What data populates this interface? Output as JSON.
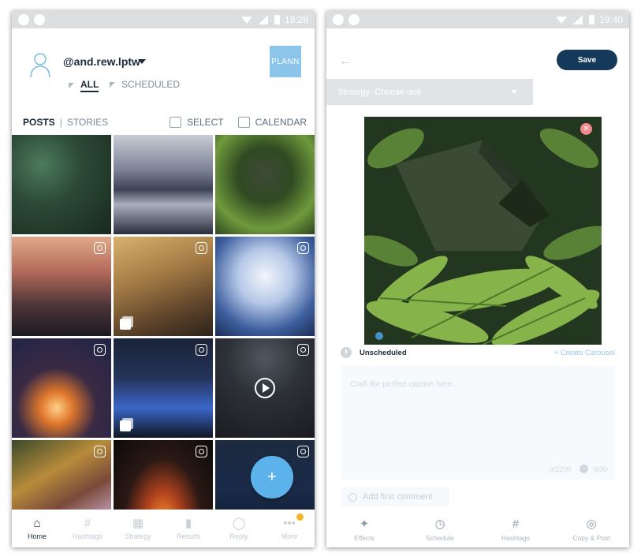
{
  "left_screen": {
    "status_bar": {
      "time": "19:28"
    },
    "header": {
      "username": "@and.rew.lptw",
      "logo_text": "PLANN",
      "filters": [
        {
          "label": "ALL",
          "active": true
        },
        {
          "label": "SCHEDULED",
          "active": false
        }
      ]
    },
    "tabs": {
      "posts": "POSTS",
      "separator": "|",
      "stories": "STORIES"
    },
    "actions": {
      "select": "SELECT",
      "calendar": "CALENDAR"
    },
    "grid_tiles": [
      {
        "theme": "green-leaves",
        "instagram": false,
        "multi": false,
        "video": false
      },
      {
        "theme": "misty-lake",
        "instagram": false,
        "multi": false,
        "video": false
      },
      {
        "theme": "fern-cabin",
        "instagram": false,
        "multi": false,
        "video": false
      },
      {
        "theme": "city-sunset",
        "instagram": true,
        "multi": false,
        "video": false
      },
      {
        "theme": "golden-field",
        "instagram": true,
        "multi": true,
        "video": false
      },
      {
        "theme": "frosted-branch",
        "instagram": true,
        "multi": false,
        "video": false
      },
      {
        "theme": "lava-night",
        "instagram": true,
        "multi": false,
        "video": false
      },
      {
        "theme": "city-night",
        "instagram": true,
        "multi": true,
        "video": false
      },
      {
        "theme": "moon-trees",
        "instagram": true,
        "multi": false,
        "video": true
      },
      {
        "theme": "squirrel",
        "instagram": true,
        "multi": false,
        "video": false
      },
      {
        "theme": "fire-sparks",
        "instagram": true,
        "multi": false,
        "video": false
      },
      {
        "theme": "night-blue",
        "instagram": true,
        "multi": false,
        "video": false
      }
    ],
    "fab_label": "+",
    "bottom_nav": [
      {
        "label": "Home",
        "icon": "home-icon",
        "glyph": "⌂",
        "active": true
      },
      {
        "label": "Hashtags",
        "icon": "hashtag-icon",
        "glyph": "#",
        "active": false
      },
      {
        "label": "Strategy",
        "icon": "grid-icon",
        "glyph": "▦",
        "active": false
      },
      {
        "label": "Results",
        "icon": "bar-chart-icon",
        "glyph": "▮",
        "active": false
      },
      {
        "label": "Reply",
        "icon": "chat-bubble-icon",
        "glyph": "◯",
        "active": false
      },
      {
        "label": "More",
        "icon": "more-dots-icon",
        "glyph": "•••",
        "active": false
      }
    ]
  },
  "right_screen": {
    "status_bar": {
      "time": "19:40"
    },
    "back_label": "←",
    "save_label": "Save",
    "strategy_placeholder": "Strategy: Choose one",
    "remove_glyph": "✕",
    "schedule_status": "Unscheduled",
    "create_carousel": "+ Create Carousel",
    "caption_placeholder": "Craft the perfect caption here...",
    "caption_count": "0/2200",
    "hashtag_count": "0/30",
    "comment_label": "Add first comment",
    "bottom_nav": [
      {
        "label": "Effects",
        "icon": "magic-wand-icon",
        "glyph": "✦"
      },
      {
        "label": "Schedule",
        "icon": "clock-icon",
        "glyph": "◷"
      },
      {
        "label": "Hashtags",
        "icon": "hashtag-icon",
        "glyph": "#"
      },
      {
        "label": "Copy & Post",
        "icon": "instagram-icon",
        "glyph": "◎"
      }
    ]
  },
  "colors": {
    "accent": "#5cb3ec",
    "save_button": "#15395a",
    "logo_bg": "#8cc4ea",
    "badge": "#f5b324",
    "remove": "#f18a8a"
  }
}
